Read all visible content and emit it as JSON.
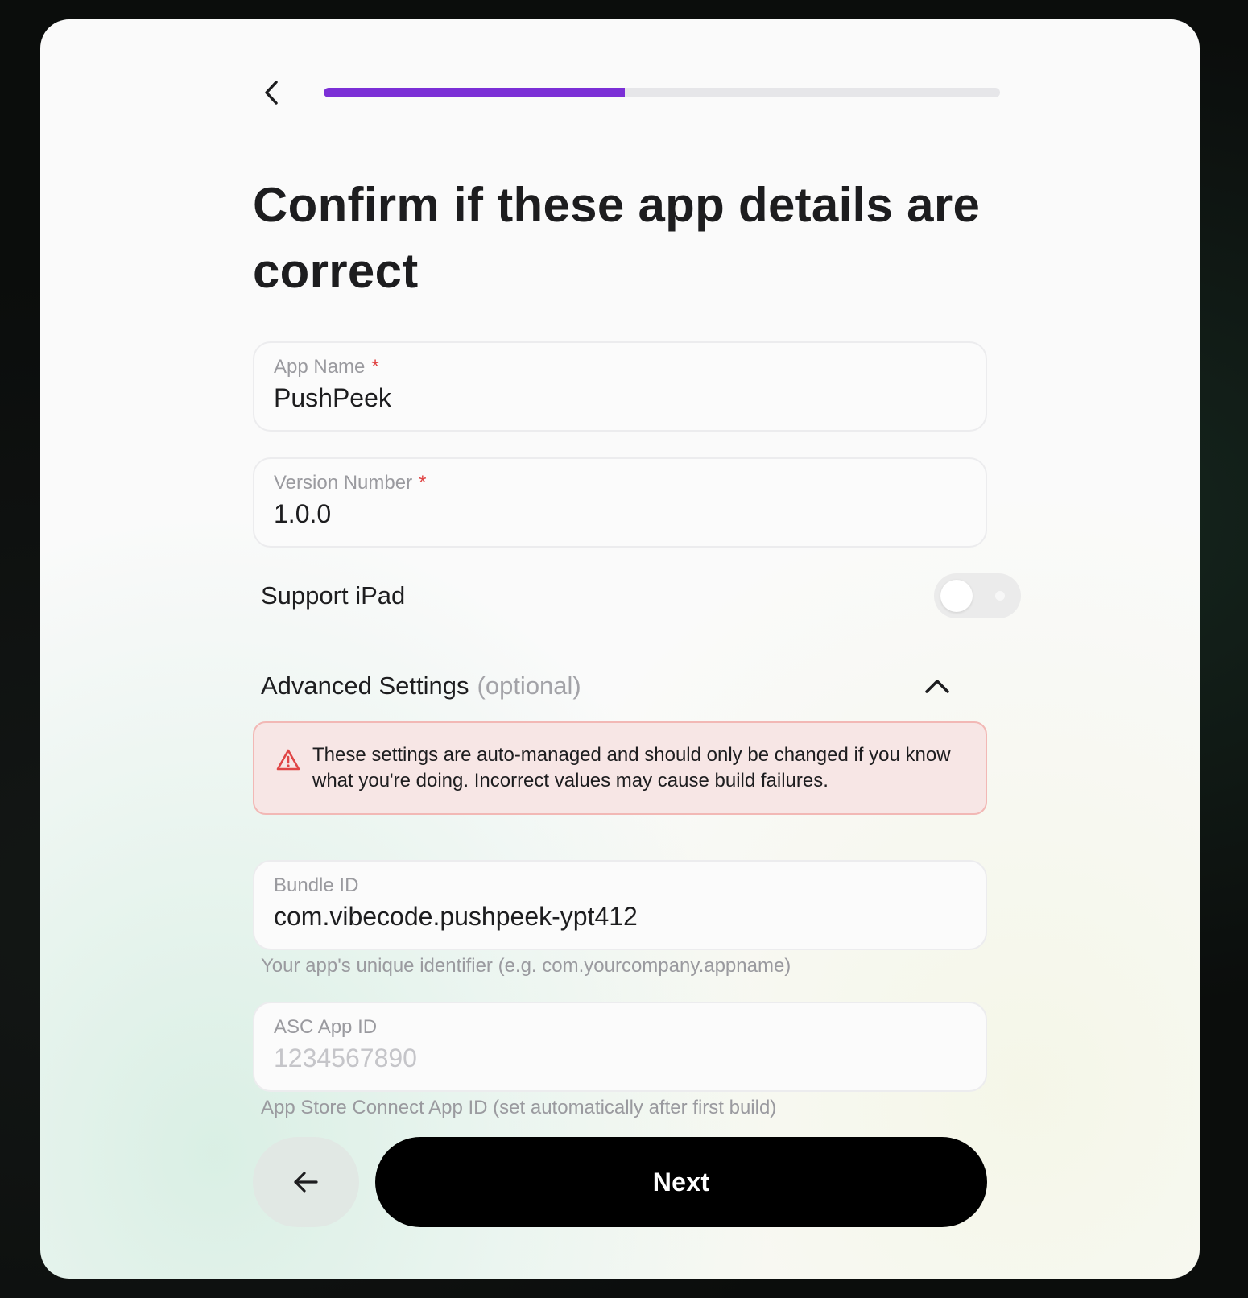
{
  "header": {
    "progress_fraction": 0.445
  },
  "title": "Confirm if these app details are correct",
  "fields": {
    "app_name": {
      "label": "App Name",
      "required_mark": "*",
      "value": "PushPeek"
    },
    "version_number": {
      "label": "Version Number",
      "required_mark": "*",
      "value": "1.0.0"
    },
    "bundle_id": {
      "label": "Bundle ID",
      "value": "com.vibecode.pushpeek-ypt412",
      "helper": "Your app's unique identifier (e.g. com.yourcompany.appname)"
    },
    "asc_app_id": {
      "label": "ASC App ID",
      "placeholder": "1234567890",
      "helper": "App Store Connect App ID (set automatically after first build)"
    }
  },
  "support_ipad": {
    "label": "Support iPad",
    "enabled": false
  },
  "advanced": {
    "label": "Advanced Settings",
    "optional_label": "(optional)",
    "expanded": true
  },
  "warning": {
    "text": "These settings are auto-managed and should only be changed if you know what you're doing. Incorrect values may cause build failures."
  },
  "footer": {
    "next_label": "Next"
  },
  "colors": {
    "accent": "#7b2fd6",
    "required": "#e04545",
    "warning_bg": "#f7e6e5",
    "warning_border": "#f2b8b5",
    "primary_button": "#000000"
  },
  "icons": {
    "back": "chevron-left-icon",
    "collapse": "chevron-up-icon",
    "warning": "warning-triangle-icon",
    "back_button": "arrow-left-icon"
  }
}
